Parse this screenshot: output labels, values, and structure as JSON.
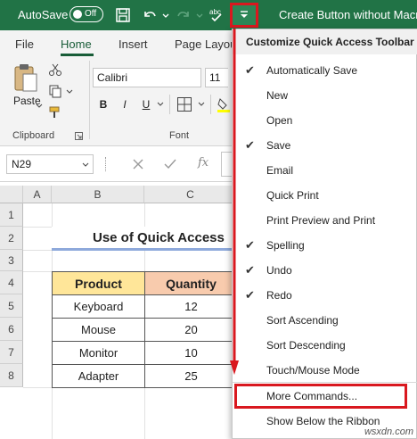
{
  "titlebar": {
    "autosave_label": "AutoSave",
    "toggle_state": "Off",
    "title": "Create Button without Macro"
  },
  "ribbon_tabs": [
    "File",
    "Home",
    "Insert",
    "Page Layout"
  ],
  "ribbon": {
    "paste_label": "Paste",
    "clipboard_group": "Clipboard",
    "font_group": "Font",
    "font_name": "Calibri",
    "font_size": "11",
    "bold": "B",
    "italic": "I",
    "underline": "U"
  },
  "formula_bar": {
    "name_box": "N29",
    "fx": "fx"
  },
  "grid": {
    "columns": [
      "A",
      "B",
      "C"
    ],
    "rows": [
      "1",
      "2",
      "3",
      "4",
      "5",
      "6",
      "7",
      "8"
    ],
    "title": "Use of Quick Access",
    "table": {
      "headers": [
        "Product",
        "Quantity"
      ],
      "rows": [
        [
          "Keyboard",
          "12"
        ],
        [
          "Mouse",
          "20"
        ],
        [
          "Monitor",
          "10"
        ],
        [
          "Adapter",
          "25"
        ]
      ]
    }
  },
  "menu": {
    "title": "Customize Quick Access Toolbar",
    "items": [
      {
        "label": "Automatically Save",
        "checked": true
      },
      {
        "label": "New",
        "checked": false
      },
      {
        "label": "Open",
        "checked": false
      },
      {
        "label": "Save",
        "checked": true
      },
      {
        "label": "Email",
        "checked": false
      },
      {
        "label": "Quick Print",
        "checked": false
      },
      {
        "label": "Print Preview and Print",
        "checked": false
      },
      {
        "label": "Spelling",
        "checked": true
      },
      {
        "label": "Undo",
        "checked": true
      },
      {
        "label": "Redo",
        "checked": true
      },
      {
        "label": "Sort Ascending",
        "checked": false
      },
      {
        "label": "Sort Descending",
        "checked": false
      },
      {
        "label": "Touch/Mouse Mode",
        "checked": false
      }
    ],
    "more_commands": "More Commands...",
    "show_below": "Show Below the Ribbon"
  },
  "watermark": "wsxdn.com",
  "colors": {
    "excel_green": "#217346",
    "highlight_red": "#d9181f",
    "header_yellow": "#ffe699",
    "header_orange": "#f8cbad"
  }
}
